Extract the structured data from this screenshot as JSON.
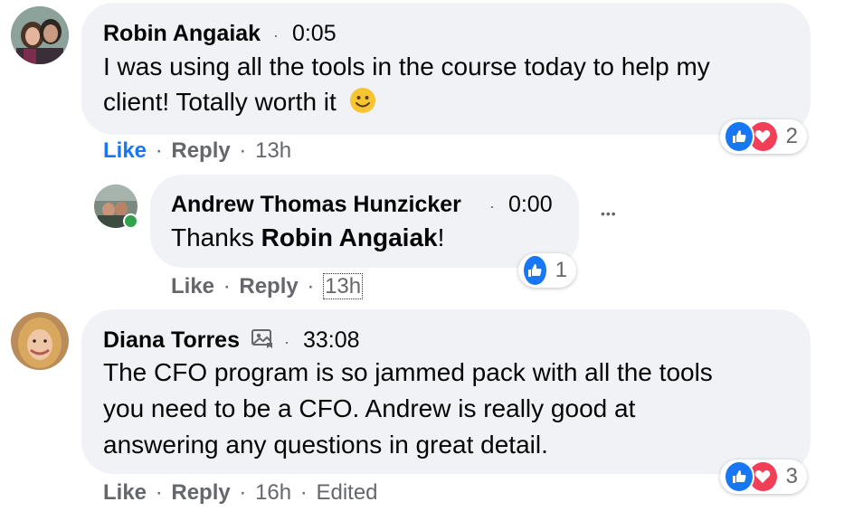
{
  "colors": {
    "bubble": "#f0f2f5",
    "like_blue": "#1877f2",
    "love_red": "#f33e58",
    "muted": "#65676b",
    "online": "#31a24c"
  },
  "comments": [
    {
      "author": "Robin Angaiak",
      "separator": "·",
      "video_time": "0:05",
      "text_line1": "I was using all the tools in the course today to help my",
      "text_line2": "client! Totally worth it",
      "emoji": "🙂",
      "actions": {
        "like": "Like",
        "reply": "Reply",
        "time": "13h",
        "sep": "·"
      },
      "reaction_count": "2",
      "reaction_icons": [
        "like-icon",
        "love-icon"
      ]
    },
    {
      "author": "Andrew Thomas Hunzicker",
      "separator": "·",
      "video_time": "0:00",
      "text_prefix": "Thanks ",
      "text_mention": "Robin Angaiak",
      "text_suffix": "!",
      "more": "•••",
      "actions": {
        "like": "Like",
        "reply": "Reply",
        "time": "13h",
        "sep": "·"
      },
      "reaction_count": "1",
      "reaction_icons": [
        "like-icon"
      ]
    },
    {
      "author": "Diana Torres",
      "separator": "·",
      "video_time": "33:08",
      "text_line1": "The CFO program is so jammed pack with all the tools",
      "text_line2": "you need to be a CFO. Andrew is really good at",
      "text_line3": "answering any questions in great detail.",
      "actions": {
        "like": "Like",
        "reply": "Reply",
        "time": "16h",
        "edited": "Edited",
        "sep": "·"
      },
      "reaction_count": "3",
      "reaction_icons": [
        "like-icon",
        "love-icon"
      ]
    }
  ]
}
